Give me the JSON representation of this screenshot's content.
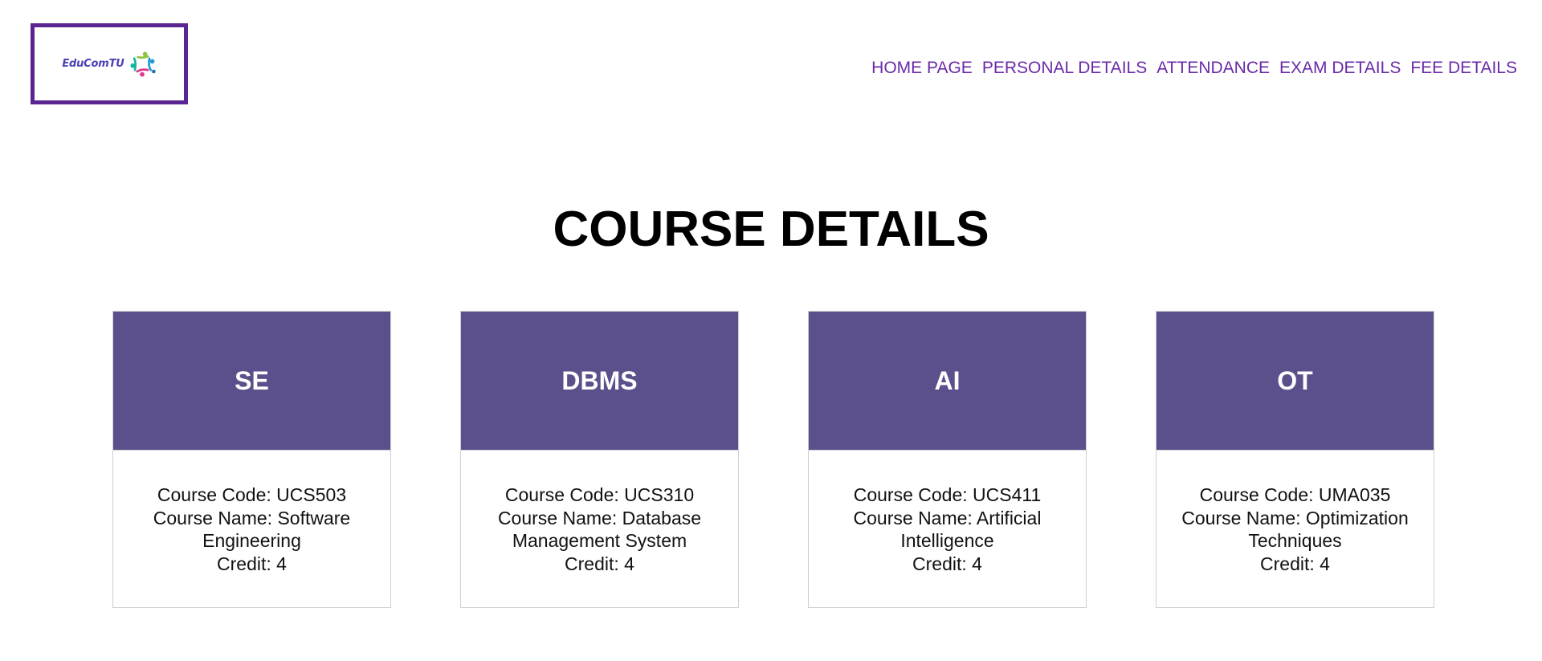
{
  "logo": {
    "text": "EduComTU",
    "icon": "people-circle-logo-icon"
  },
  "nav": {
    "items": [
      {
        "label": "HOME PAGE"
      },
      {
        "label": "PERSONAL DETAILS"
      },
      {
        "label": "ATTENDANCE"
      },
      {
        "label": "EXAM DETAILS"
      },
      {
        "label": "FEE DETAILS"
      }
    ]
  },
  "page": {
    "title": "COURSE DETAILS"
  },
  "courses": [
    {
      "abbr": "SE",
      "code": "Course Code: UCS503",
      "name": "Course Name: Software Engineering",
      "credit": "Credit: 4"
    },
    {
      "abbr": "DBMS",
      "code": "Course Code: UCS310",
      "name": "Course Name: Database Management System",
      "credit": "Credit: 4"
    },
    {
      "abbr": "AI",
      "code": "Course Code: UCS411",
      "name": "Course Name: Artificial Intelligence",
      "credit": "Credit: 4"
    },
    {
      "abbr": "OT",
      "code": "Course Code: UMA035",
      "name": "Course Name: Optimization Techniques",
      "credit": "Credit: 4"
    }
  ],
  "colors": {
    "accent": "#5a2590",
    "nav_link": "#6a2aa8",
    "card_header": "#5b4f8c",
    "card_border": "#cfcfcf"
  }
}
